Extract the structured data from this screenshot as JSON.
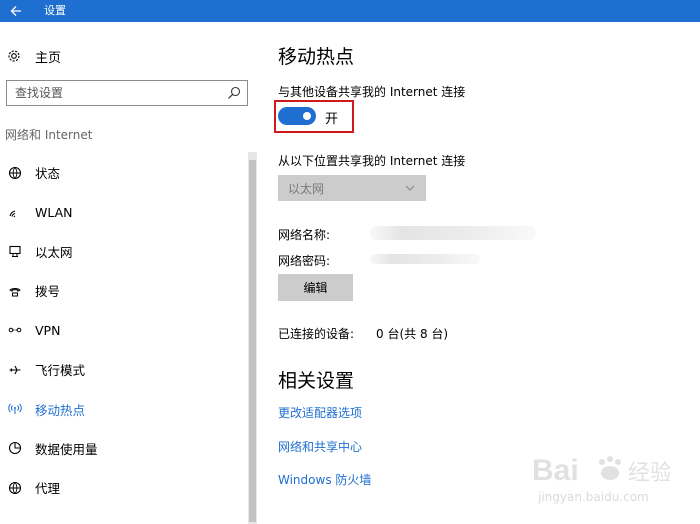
{
  "window": {
    "title": "设置"
  },
  "sidebar": {
    "home_label": "主页",
    "search_placeholder": "查找设置",
    "section_label": "网络和 Internet",
    "items": [
      {
        "label": "状态",
        "icon": "globe-status-icon"
      },
      {
        "label": "WLAN",
        "icon": "wifi-icon"
      },
      {
        "label": "以太网",
        "icon": "ethernet-icon"
      },
      {
        "label": "拨号",
        "icon": "dialup-icon"
      },
      {
        "label": "VPN",
        "icon": "vpn-icon"
      },
      {
        "label": "飞行模式",
        "icon": "airplane-icon"
      },
      {
        "label": "移动热点",
        "icon": "hotspot-icon",
        "active": true
      },
      {
        "label": "数据使用量",
        "icon": "data-usage-icon"
      },
      {
        "label": "代理",
        "icon": "proxy-globe-icon"
      }
    ]
  },
  "main": {
    "title": "移动热点",
    "share_label": "与其他设备共享我的 Internet 连接",
    "toggle_state": "开",
    "share_from_label": "从以下位置共享我的 Internet 连接",
    "share_from_value": "以太网",
    "network_name_label": "网络名称:",
    "network_password_label": "网络密码:",
    "edit_button": "编辑",
    "connected_devices_label": "已连接的设备:",
    "connected_devices_value": "0 台(共 8 台)",
    "related_title": "相关设置",
    "links": [
      "更改适配器选项",
      "网络和共享中心",
      "Windows 防火墙"
    ]
  },
  "watermark": {
    "brand": "Baidu经验",
    "url": "jingyan.baidu.com"
  },
  "colors": {
    "accent": "#1e6fd0",
    "highlight": "#d0191b",
    "titlebar": "#1e6fd0"
  }
}
